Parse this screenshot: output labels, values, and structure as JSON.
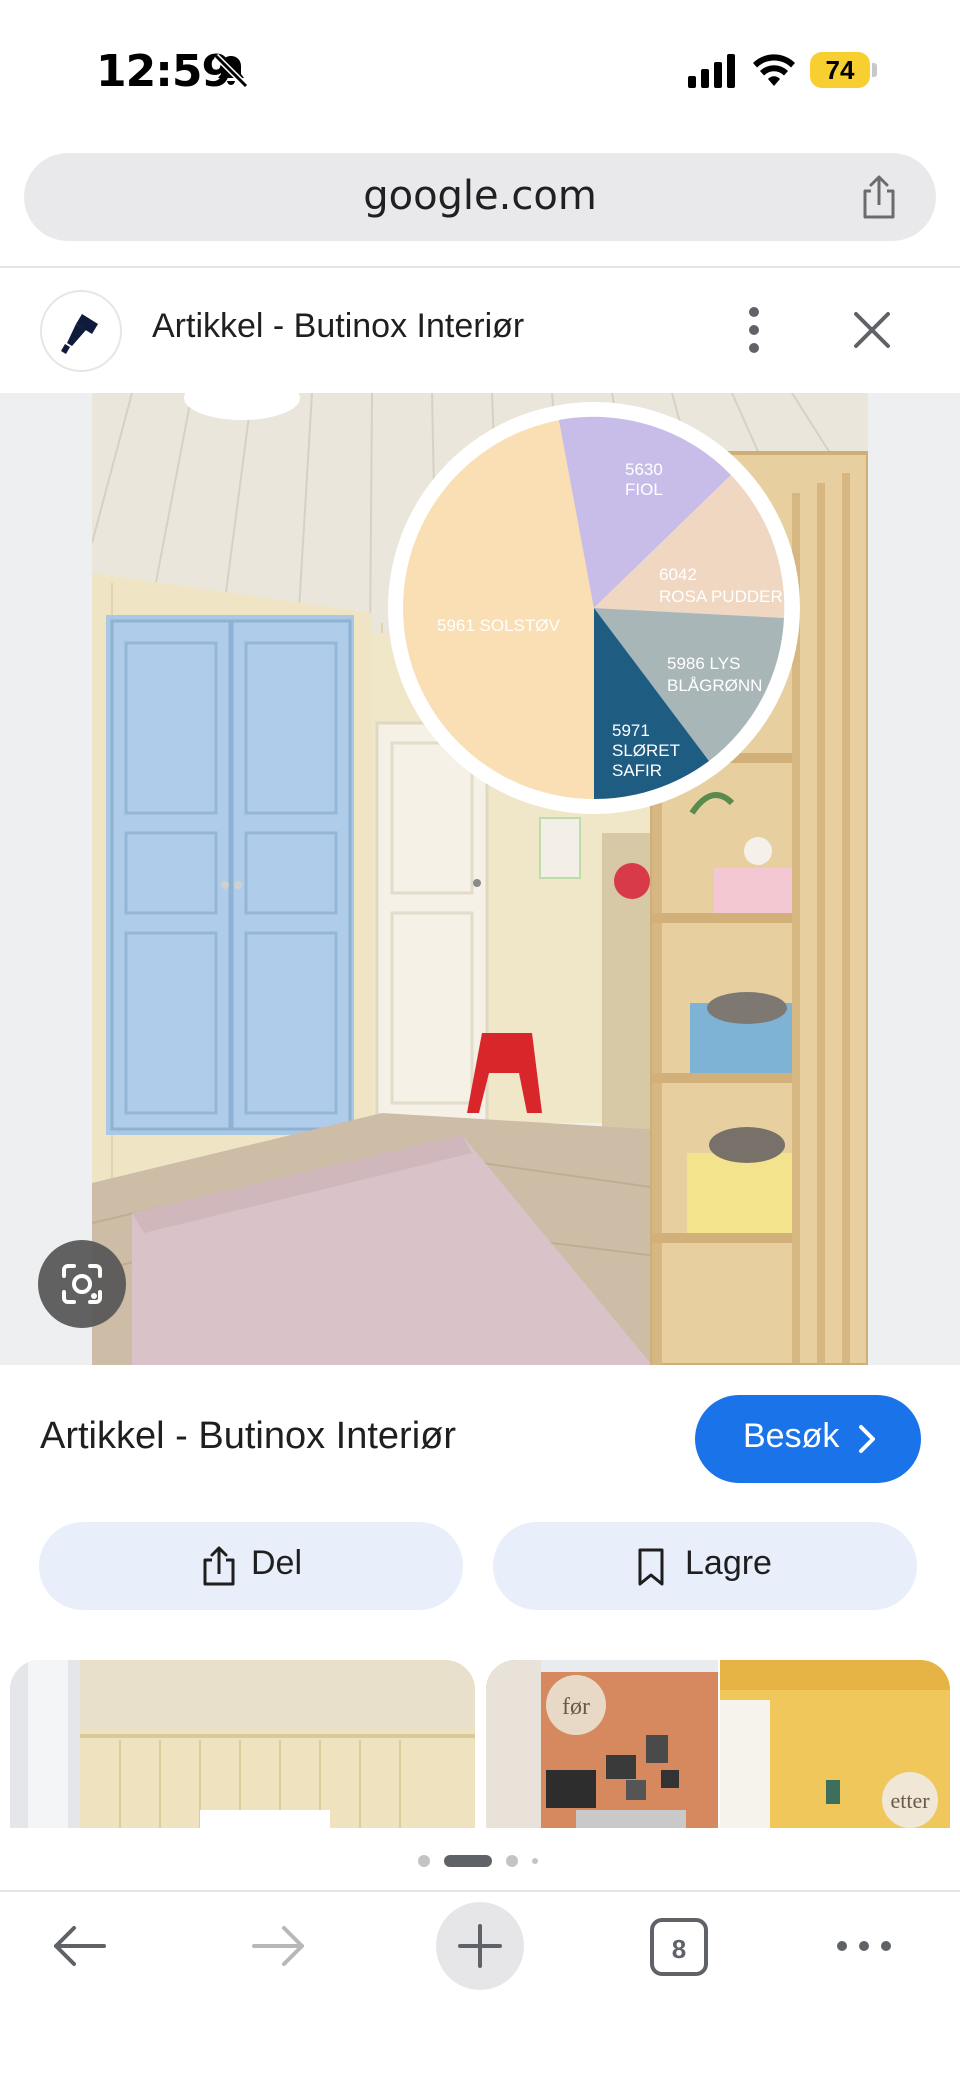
{
  "status_bar": {
    "time": "12:59",
    "battery": "74"
  },
  "browser": {
    "url": "google.com",
    "tab_count": "8"
  },
  "result": {
    "site_title": "Artikkel - Butinox Interiør",
    "title": "Artikkel - Butinox Interiør"
  },
  "actions": {
    "visit": "Besøk",
    "share": "Del",
    "save": "Lagre"
  },
  "palette": {
    "solstov": "5961 SOLSTØV",
    "fiol": [
      "5630",
      "FIOL"
    ],
    "rosa": [
      "6042",
      "ROSA PUDDER"
    ],
    "blagronn": [
      "5986 LYS",
      "BLÅGRØNN"
    ],
    "safir": [
      "5971",
      "SLØRET",
      "SAFIR"
    ]
  },
  "thumbnails": {
    "before": "før",
    "after": "etter"
  },
  "colors": {
    "accent": "#1a73e8",
    "pill_bg": "#e8eefa",
    "battery": "#f7cf30"
  },
  "icons": [
    "bell-slash-icon",
    "cellular-icon",
    "wifi-icon",
    "share-icon",
    "paint-roller-icon",
    "more-vert-icon",
    "close-icon",
    "lens-icon",
    "chevron-right-icon",
    "bookmark-icon",
    "back-arrow-icon",
    "forward-arrow-icon",
    "plus-icon",
    "tabs-icon",
    "more-horiz-icon"
  ],
  "pagination": {
    "pages": 4,
    "active": 2
  }
}
